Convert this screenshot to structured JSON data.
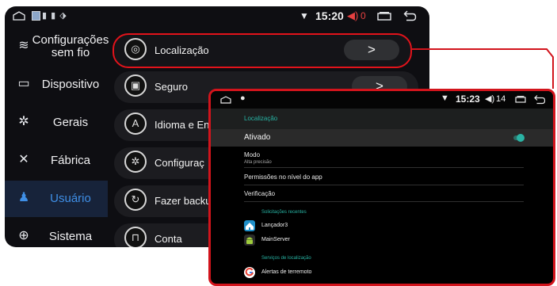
{
  "statusbar": {
    "notif_icons": "▮ ▮ ⬗",
    "time": "15:20",
    "volume_level": "0"
  },
  "sidebar": {
    "items": [
      {
        "label": "Configurações sem fio",
        "icon": "wifi-icon"
      },
      {
        "label": "Dispositivo",
        "icon": "monitor-icon"
      },
      {
        "label": "Gerais",
        "icon": "gear-icon"
      },
      {
        "label": "Fábrica",
        "icon": "tools-icon"
      },
      {
        "label": "Usuário",
        "icon": "user-icon",
        "active": true
      },
      {
        "label": "Sistema",
        "icon": "globe-icon"
      }
    ]
  },
  "menu": {
    "items": [
      {
        "label": "Localização",
        "icon": "location-icon",
        "arrow": ">"
      },
      {
        "label": "Seguro",
        "icon": "lock-icon",
        "arrow": ">"
      },
      {
        "label": "Idioma e En",
        "icon": "language-icon"
      },
      {
        "label": "Configuraç",
        "icon": "settings-icon"
      },
      {
        "label": "Fazer backu",
        "icon": "backup-icon"
      },
      {
        "label": "Conta",
        "icon": "android-icon"
      }
    ]
  },
  "inset": {
    "time": "15:23",
    "volume_level": "14",
    "header_title": "Localização",
    "toggle_label": "Ativado",
    "mode_label": "Modo",
    "mode_value": "Alta precisão",
    "app_permissions": "Permissões no nível do app",
    "verification": "Verificação",
    "recent_requests_title": "Solicitações recentes",
    "recent_apps": [
      "Lançador3",
      "MainServer"
    ],
    "location_services_title": "Serviços de localização",
    "services": [
      "Alertas de terremoto"
    ]
  },
  "colors": {
    "accent_blue": "#3f8fe6",
    "highlight_red": "#e2131b",
    "teal": "#27b3a3"
  }
}
